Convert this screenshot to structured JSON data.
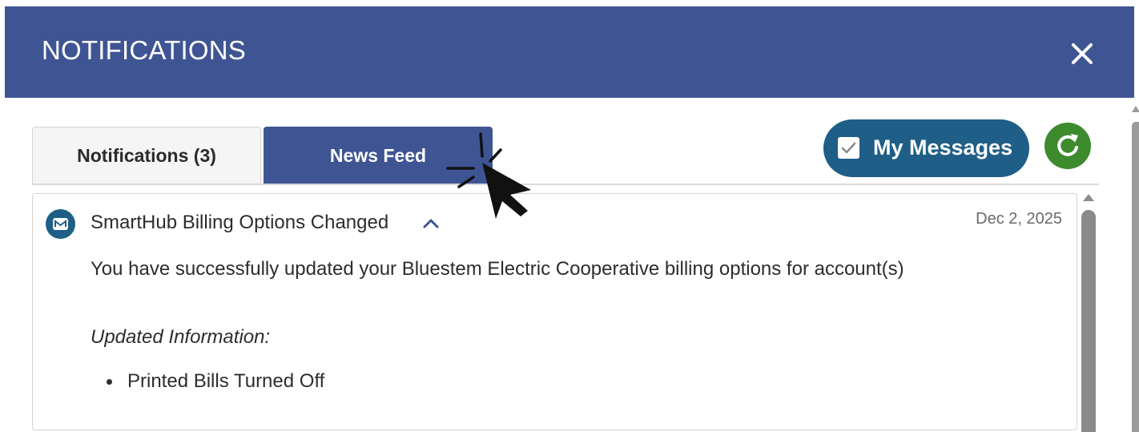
{
  "header": {
    "title": "NOTIFICATIONS",
    "close_icon": "close-icon",
    "color": "#3f5593"
  },
  "tabs": [
    {
      "label": "Notifications (3)",
      "active": false
    },
    {
      "label": "News Feed",
      "active": true
    }
  ],
  "toolbar": {
    "my_messages_label": "My Messages",
    "my_messages_checked": true,
    "my_messages_color": "#1f5e86",
    "refresh_icon": "refresh-icon",
    "refresh_color": "#3e8b2e"
  },
  "message": {
    "icon": "mail-icon",
    "title": "SmartHub Billing Options Changed",
    "expanded": true,
    "date": "Dec 2, 2025",
    "body": "You have successfully updated your Bluestem Electric Cooperative billing options for account(s)",
    "subheading": "Updated Information:",
    "items": [
      "Printed Bills Turned Off"
    ]
  },
  "cursor_icon": "pointer-click-icon"
}
